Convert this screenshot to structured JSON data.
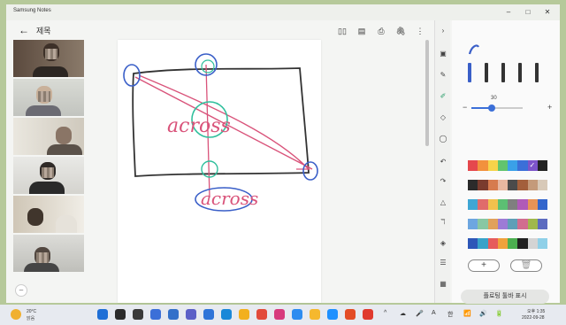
{
  "window": {
    "app_title": "Samsung Notes",
    "controls": {
      "minimize": "–",
      "maximize": "□",
      "close": "✕"
    }
  },
  "note": {
    "back_glyph": "←",
    "title": "제목",
    "header_tools": [
      "book-icon",
      "pages-icon",
      "print-icon",
      "attach-icon",
      "more-icon"
    ]
  },
  "drawing": {
    "annotations": [
      "across",
      "across"
    ],
    "stroke_colors": {
      "black": "#333333",
      "blue": "#3a5fc8",
      "red": "#d9537a",
      "teal": "#2fbf9c"
    }
  },
  "video_tiles": 6,
  "right_rail": {
    "expand_glyph": "›",
    "icons": [
      "view-icon",
      "pen-icon",
      "highlighter-icon",
      "eraser-icon",
      "lasso-icon",
      "undo-icon",
      "redo-icon",
      "shape-icon",
      "text-icon",
      "fill-icon",
      "layers-icon",
      "image-icon"
    ]
  },
  "pen_panel": {
    "size_value": "30",
    "size_level": 0.4,
    "minus": "−",
    "plus": "+",
    "add_glyph": "+",
    "delete_glyph": "🗑",
    "toolbar_toggle_label": "플로팅 툴바 표시",
    "palettes": [
      [
        "#e5484d",
        "#f2913d",
        "#f6d34a",
        "#62c46d",
        "#3aa0e8",
        "#3b6fd8",
        "#7d54c9",
        "#222222"
      ],
      [
        "#2b2b2b",
        "#7a3b2e",
        "#d67b4e",
        "#e7b7a0",
        "#4b4b4b",
        "#a35f3c",
        "#c49a7a",
        "#d8c9b8"
      ],
      [
        "#3fa6d4",
        "#e06b6b",
        "#f1c14d",
        "#5cbf73",
        "#7f7f7f",
        "#b05ab8",
        "#e89356",
        "#3366cc"
      ],
      [
        "#6da6e0",
        "#88c7a3",
        "#e1a15c",
        "#9d7bd6",
        "#5f9fb7",
        "#d16d8f",
        "#a0b84c",
        "#5c6bc0"
      ],
      [
        "#2e57b8",
        "#38a2c9",
        "#e65c5c",
        "#f0a23c",
        "#4caf50",
        "#212121",
        "#d4d4d4",
        "#8fd0e8"
      ]
    ]
  },
  "taskbar": {
    "weather_temp": "20°C",
    "weather_desc": "맑음",
    "apps": [
      "#1f6fd6",
      "#2b2b2b",
      "#3a3a3a",
      "#3b6fd8",
      "#3370c9",
      "#5b5fc7",
      "#2f74d8",
      "#1a88d8",
      "#f2b01e",
      "#e24a3b",
      "#d73a7d",
      "#2d8cf0",
      "#f5b82e",
      "#1e90ff",
      "#e34c26",
      "#e03a2e"
    ],
    "tray_glyphs": [
      "^",
      "☁",
      "🎤",
      "A",
      "한",
      "📶",
      "🔊",
      "🔋"
    ],
    "clock_time": "오후 1:35",
    "clock_date": "2022-09-28"
  }
}
